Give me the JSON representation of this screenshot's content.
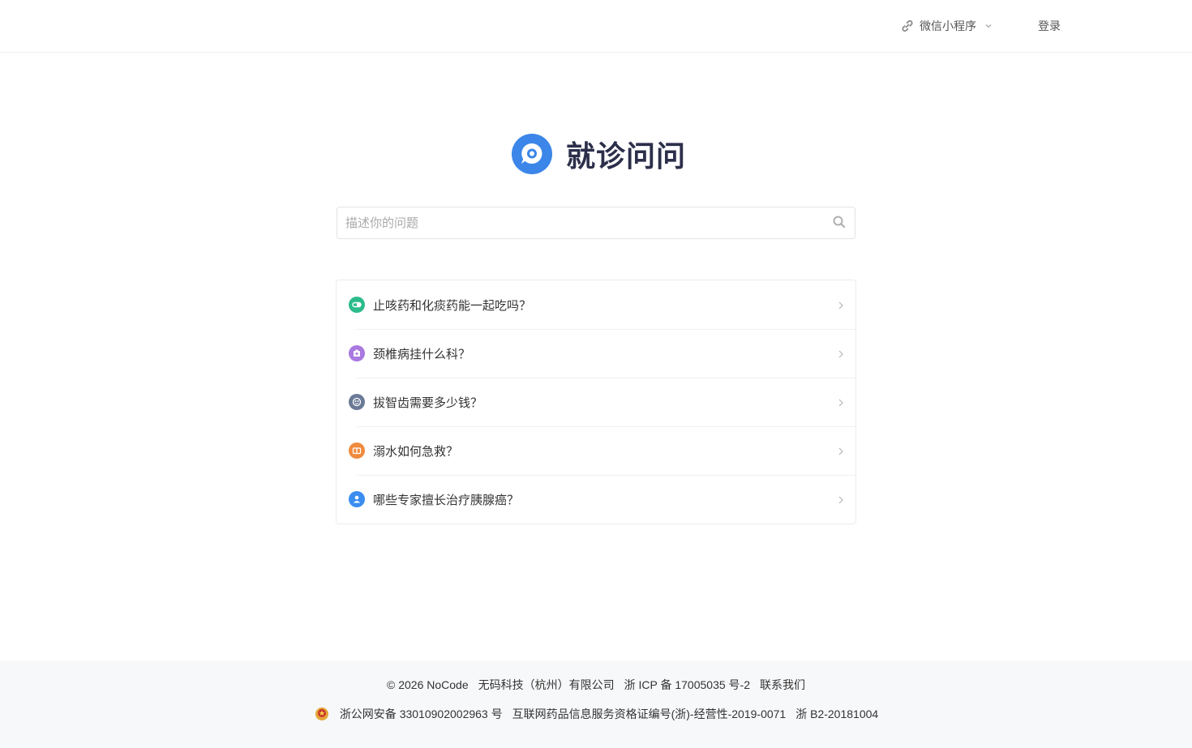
{
  "header": {
    "mini_program_label": "微信小程序",
    "login_label": "登录"
  },
  "brand": {
    "title": "就诊问问",
    "logo_color": "#3b86e8"
  },
  "search": {
    "placeholder": "描述你的问题",
    "value": ""
  },
  "questions": [
    {
      "text": "止咳药和化痰药能一起吃吗？",
      "icon": "pill-icon",
      "color": "#2dbb8b"
    },
    {
      "text": "颈椎病挂什么科？",
      "icon": "hospital-icon",
      "color": "#a979e0"
    },
    {
      "text": "拔智齿需要多少钱？",
      "icon": "tooth-icon",
      "color": "#6a7a96"
    },
    {
      "text": "溺水如何急救？",
      "icon": "first-aid-icon",
      "color": "#f08a3e"
    },
    {
      "text": "哪些专家擅长治疗胰腺癌？",
      "icon": "doctor-icon",
      "color": "#3b8ef0"
    }
  ],
  "footer": {
    "copyright": "© 2026 NoCode",
    "company": "无码科技（杭州）有限公司",
    "icp": "浙 ICP 备 17005035 号-2",
    "contact": "联系我们",
    "police_record": "浙公网安备 33010902002963 号",
    "drug_license": "互联网药品信息服务资格证编号(浙)-经营性-2019-0071",
    "b2_license": "浙 B2-20181004"
  }
}
